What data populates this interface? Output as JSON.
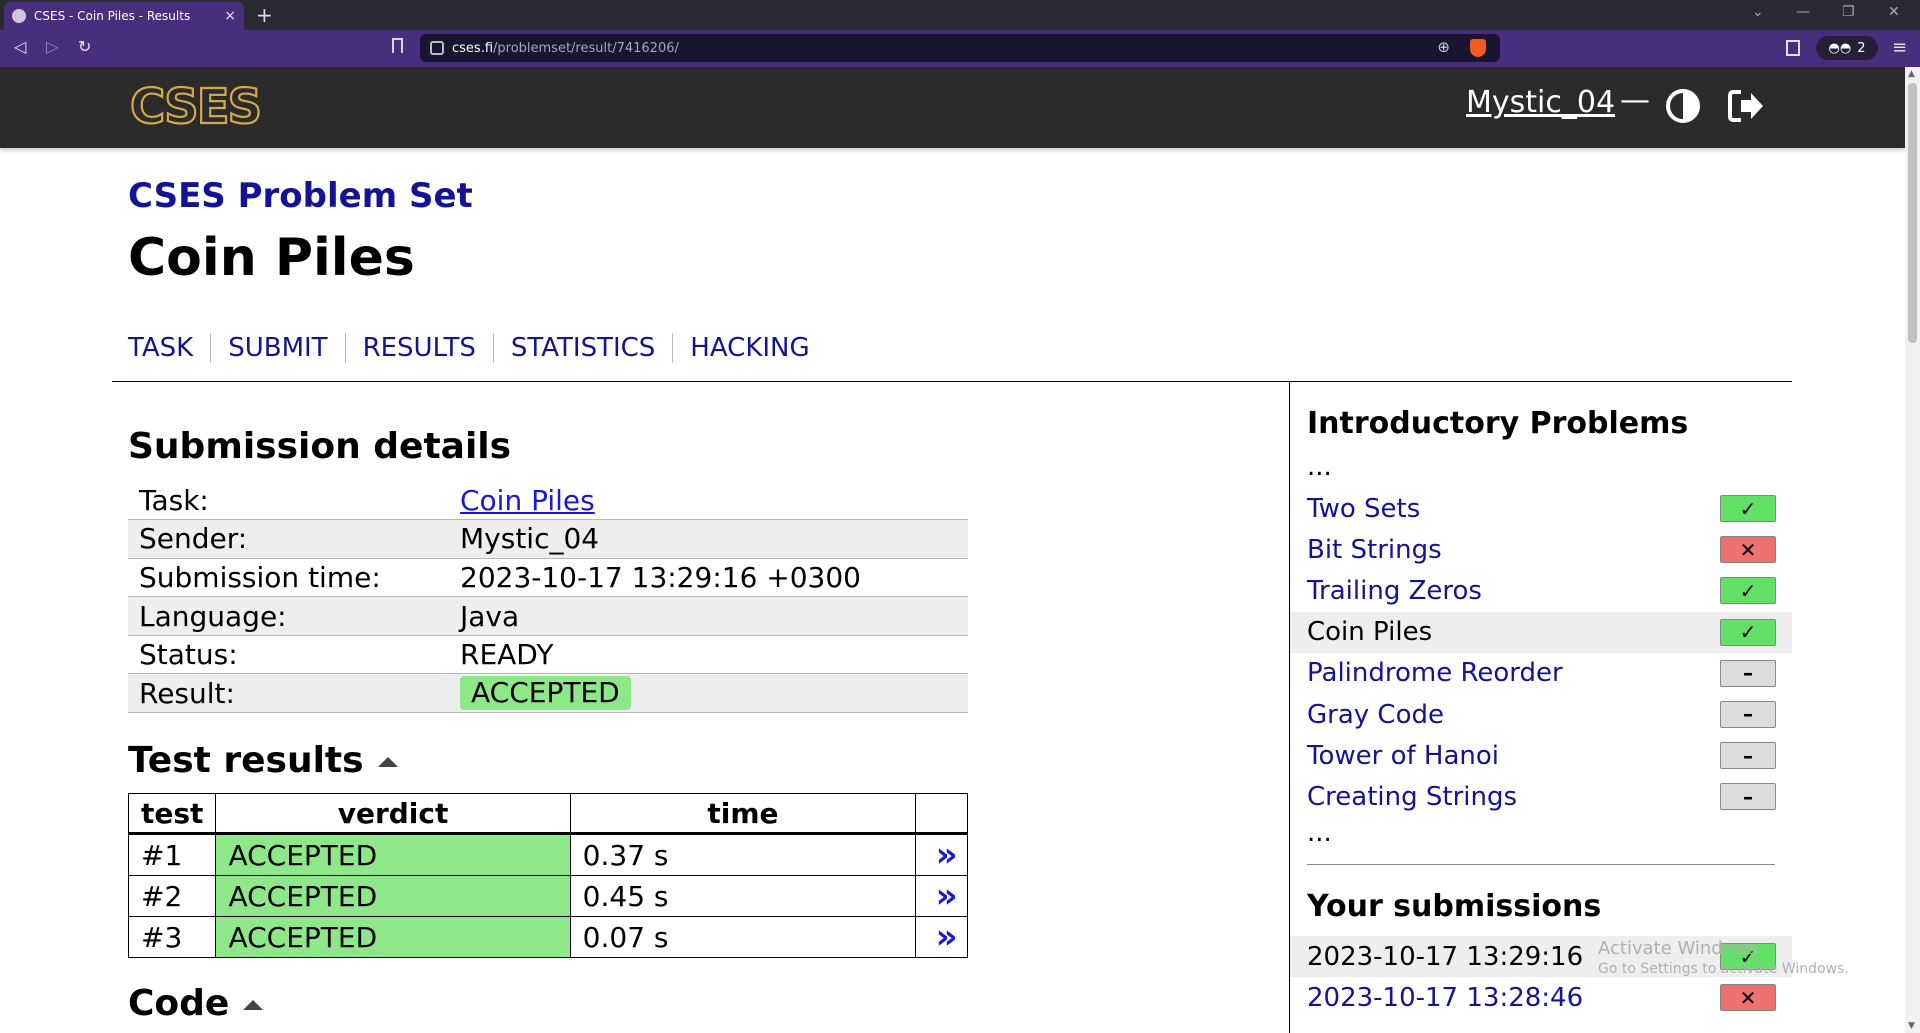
{
  "browser": {
    "tab_title": "CSES - Coin Piles - Results",
    "tab_close": "×",
    "new_tab": "+",
    "url_host": "cses.fi",
    "url_path": "/problemset/result/7416206/",
    "extension_count": "2"
  },
  "header": {
    "logo_text": "CSES",
    "username": "Mystic_04",
    "dash": "—"
  },
  "page": {
    "subtitle": "CSES Problem Set",
    "title": "Coin Piles",
    "tabs": [
      "TASK",
      "SUBMIT",
      "RESULTS",
      "STATISTICS",
      "HACKING"
    ]
  },
  "submission": {
    "heading": "Submission details",
    "rows": [
      {
        "key": "Task:",
        "value": "Coin Piles"
      },
      {
        "key": "Sender:",
        "value": "Mystic_04"
      },
      {
        "key": "Submission time:",
        "value": "2023-10-17 13:29:16 +0300"
      },
      {
        "key": "Language:",
        "value": "Java"
      },
      {
        "key": "Status:",
        "value": "READY"
      },
      {
        "key": "Result:",
        "value": "ACCEPTED"
      }
    ]
  },
  "tests": {
    "heading": "Test results",
    "columns": [
      "test",
      "verdict",
      "time"
    ],
    "rows": [
      {
        "test": "#1",
        "verdict": "ACCEPTED",
        "time": "0.37 s"
      },
      {
        "test": "#2",
        "verdict": "ACCEPTED",
        "time": "0.45 s"
      },
      {
        "test": "#3",
        "verdict": "ACCEPTED",
        "time": "0.07 s"
      }
    ],
    "view_glyph": "»"
  },
  "code": {
    "heading": "Code"
  },
  "sidebar": {
    "section_title": "Introductory Problems",
    "ellipsis": "...",
    "problems": [
      {
        "name": "Two Sets",
        "status": "ok"
      },
      {
        "name": "Bit Strings",
        "status": "bad"
      },
      {
        "name": "Trailing Zeros",
        "status": "ok"
      },
      {
        "name": "Coin Piles",
        "status": "ok",
        "current": true
      },
      {
        "name": "Palindrome Reorder",
        "status": "none"
      },
      {
        "name": "Gray Code",
        "status": "none"
      },
      {
        "name": "Tower of Hanoi",
        "status": "none"
      },
      {
        "name": "Creating Strings",
        "status": "none"
      }
    ],
    "submissions_title": "Your submissions",
    "submissions": [
      {
        "time": "2023-10-17 13:29:16",
        "status": "ok",
        "current": true
      },
      {
        "time": "2023-10-17 13:28:46",
        "status": "bad"
      }
    ],
    "status_glyphs": {
      "ok": "✓",
      "bad": "✕",
      "none": "–"
    },
    "status_colors": {
      "ok": "#62e066",
      "bad": "#f07070",
      "none": "#dcdcdc"
    }
  },
  "watermark": {
    "line1": "Activate Windows",
    "line2": "Go to Settings to activate Windows."
  }
}
